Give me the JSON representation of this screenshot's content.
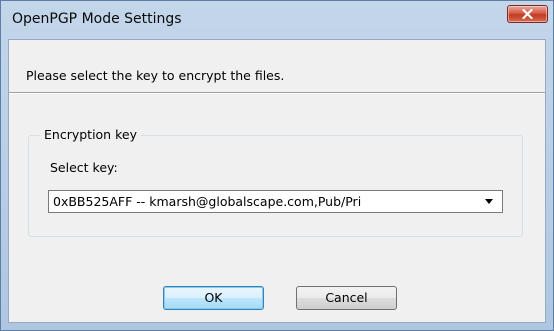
{
  "window": {
    "title": "OpenPGP Mode Settings"
  },
  "dialog": {
    "prompt": "Please select the key to encrypt the files.",
    "group": {
      "legend": "Encryption key",
      "select_label": "Select key:",
      "selected_key": "0xBB525AFF -- kmarsh@globalscape.com,Pub/Pri"
    },
    "buttons": {
      "ok": "OK",
      "cancel": "Cancel"
    }
  },
  "icons": {
    "close": "close-icon",
    "dropdown": "chevron-down-icon"
  },
  "colors": {
    "titlebar": "#b9cfe6",
    "close_button": "#c94a33",
    "client_background": "#f0f0f0",
    "default_button_border": "#3c7fb1"
  }
}
